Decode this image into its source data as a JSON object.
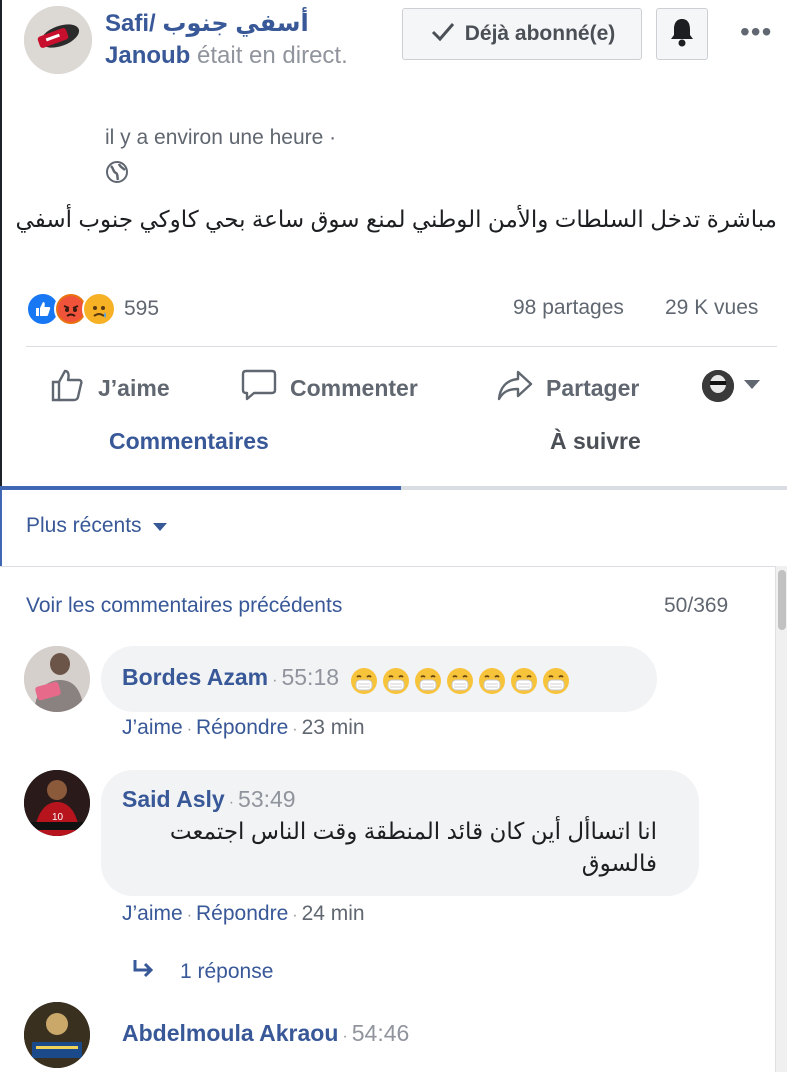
{
  "post": {
    "page_name": "Safi/ أسفي جنوب Janoub",
    "was_live": "était en direct.",
    "timestamp": "il y a environ une heure ·",
    "subscribed_label": "Déjà abonné(e)",
    "text": "مباشرة تدخل السلطات والأمن الوطني لمنع سوق ساعة بحي كاوكي جنوب أسفي",
    "reaction_count": "595",
    "shares": "98 partages",
    "views": "29 K vues",
    "reactions": [
      "like-icon",
      "angry-icon",
      "sad-icon"
    ]
  },
  "actions": {
    "like": "J’aime",
    "comment": "Commenter",
    "share": "Partager"
  },
  "tabs": {
    "comments": "Commentaires",
    "follow": "À suivre"
  },
  "comments_section": {
    "sort_label": "Plus récents",
    "view_previous": "Voir les commentaires précédents",
    "count": "50/369"
  },
  "comments": [
    {
      "author": "Bordes Azam",
      "time": "55:18",
      "emoji_count": 7,
      "like": "J’aime",
      "reply": "Répondre",
      "age": "23 min"
    },
    {
      "author": "Said Asly",
      "time": "53:49",
      "text": "انا اتساأل أين كان قائد المنطقة وقت الناس اجتمعت فالسوق",
      "like": "J’aime",
      "reply": "Répondre",
      "age": "24 min",
      "replies": "1 réponse"
    },
    {
      "author": "Abdelmoula Akraou",
      "time": "54:46"
    }
  ],
  "colors": {
    "link_blue": "#385898",
    "accent_blue": "#4267b2",
    "gray_text": "#606770",
    "bubble_bg": "#f2f3f5"
  }
}
